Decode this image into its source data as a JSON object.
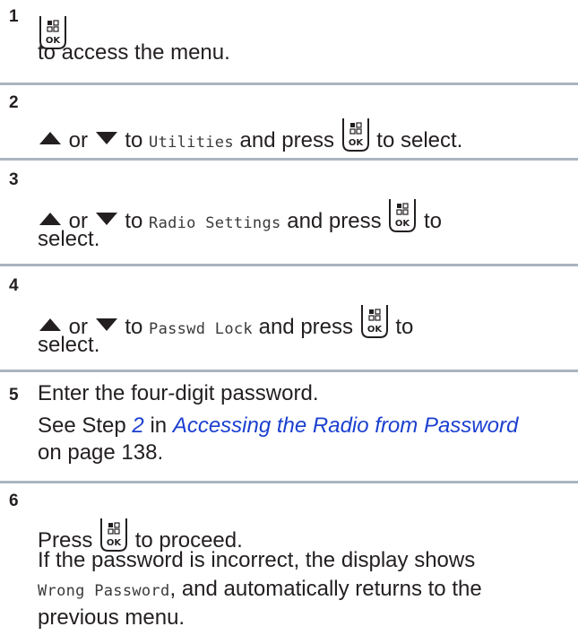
{
  "steps": [
    {
      "number": "1",
      "text_after_key": "to access the menu."
    },
    {
      "number": "2",
      "or": "or",
      "to": "to",
      "target": "Utilities",
      "and_press": "and press",
      "suffix": "to select."
    },
    {
      "number": "3",
      "or": "or",
      "to": "to",
      "target": "Radio Settings",
      "and_press": "and press",
      "suffix_a": "to",
      "suffix_b": "select."
    },
    {
      "number": "4",
      "or": "or",
      "to": "to",
      "target": "Passwd Lock",
      "and_press": "and press",
      "suffix_a": "to",
      "suffix_b": "select."
    },
    {
      "number": "5",
      "text": "Enter the four-digit password.",
      "see_prefix": "See Step",
      "step_ref": "2",
      "in": "in",
      "link_title": "Accessing the Radio from Password",
      "page_ref": "on page 138."
    },
    {
      "number": "6",
      "press": "Press",
      "proceed": "to proceed.",
      "note_a": "If the password is incorrect, the display shows",
      "note_mono": "Wrong Password",
      "note_b": ", and automatically returns to the",
      "note_c": "previous menu."
    }
  ],
  "icons": {
    "ok_key": "menu-ok-key-icon",
    "up": "up-arrow-icon",
    "down": "down-arrow-icon"
  },
  "colors": {
    "text": "#231f20",
    "link": "#1a3fd0",
    "rule": "#a9b4bf"
  }
}
